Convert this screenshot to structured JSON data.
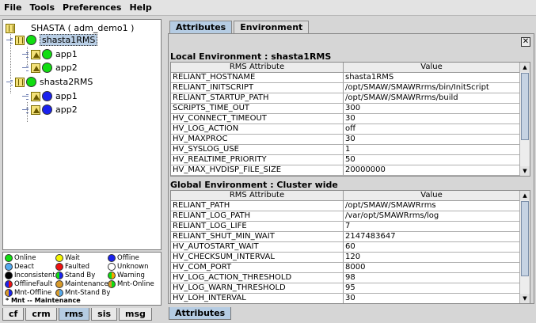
{
  "menu": [
    "File",
    "Tools",
    "Preferences",
    "Help"
  ],
  "tree": {
    "root_label": "SHASTA ( adm_demo1 )",
    "nodes": [
      {
        "label": "shasta1RMS",
        "apps": [
          "app1",
          "app2"
        ]
      },
      {
        "label": "shasta2RMS",
        "apps": [
          "app1",
          "app2"
        ]
      }
    ]
  },
  "legend": {
    "items": [
      "Online",
      "Wait",
      "Offline",
      "Deact",
      "Faulted",
      "Unknown",
      "Inconsistent",
      "Stand By",
      "Warning",
      "OfflineFault",
      "Maintenance",
      "Mnt-Online",
      "Mnt-Offline",
      "Mnt-Stand By"
    ],
    "note": "* Mnt -- Maintenance"
  },
  "left_tabs": [
    "cf",
    "crm",
    "rms",
    "sis",
    "msg"
  ],
  "right_tabs": [
    "Attributes",
    "Environment"
  ],
  "close_glyph": "✕",
  "local_env": {
    "title": "Local Environment : shasta1RMS",
    "headers": [
      "RMS Attribute",
      "Value"
    ],
    "rows": [
      [
        "RELIANT_HOSTNAME",
        "shasta1RMS"
      ],
      [
        "RELIANT_INITSCRIPT",
        "/opt/SMAW/SMAWRrms/bin/InitScript"
      ],
      [
        "RELIANT_STARTUP_PATH",
        "/opt/SMAW/SMAWRrms/build"
      ],
      [
        "SCRIPTS_TIME_OUT",
        "300"
      ],
      [
        "HV_CONNECT_TIMEOUT",
        "30"
      ],
      [
        "HV_LOG_ACTION",
        "off"
      ],
      [
        "HV_MAXPROC",
        "30"
      ],
      [
        "HV_SYSLOG_USE",
        "1"
      ],
      [
        "HV_REALTIME_PRIORITY",
        "50"
      ],
      [
        "HV_MAX_HVDISP_FILE_SIZE",
        "20000000"
      ]
    ]
  },
  "global_env": {
    "title": "Global Environment : Cluster wide",
    "headers": [
      "RMS Attribute",
      "Value"
    ],
    "rows": [
      [
        "RELIANT_PATH",
        "/opt/SMAW/SMAWRrms"
      ],
      [
        "RELIANT_LOG_PATH",
        "/var/opt/SMAWRrms/log"
      ],
      [
        "RELIANT_LOG_LIFE",
        "7"
      ],
      [
        "RELIANT_SHUT_MIN_WAIT",
        "2147483647"
      ],
      [
        "HV_AUTOSTART_WAIT",
        "60"
      ],
      [
        "HV_CHECKSUM_INTERVAL",
        "120"
      ],
      [
        "HV_COM_PORT",
        "8000"
      ],
      [
        "HV_LOG_ACTION_THRESHOLD",
        "98"
      ],
      [
        "HV_LOG_WARN_THRESHOLD",
        "95"
      ],
      [
        "HV_LOH_INTERVAL",
        "30"
      ]
    ]
  },
  "bottom_right_tab": "Attributes",
  "colors": {
    "accent_tab": "#b5cce3",
    "online": "#11dd11",
    "offline": "#1a22ee"
  }
}
